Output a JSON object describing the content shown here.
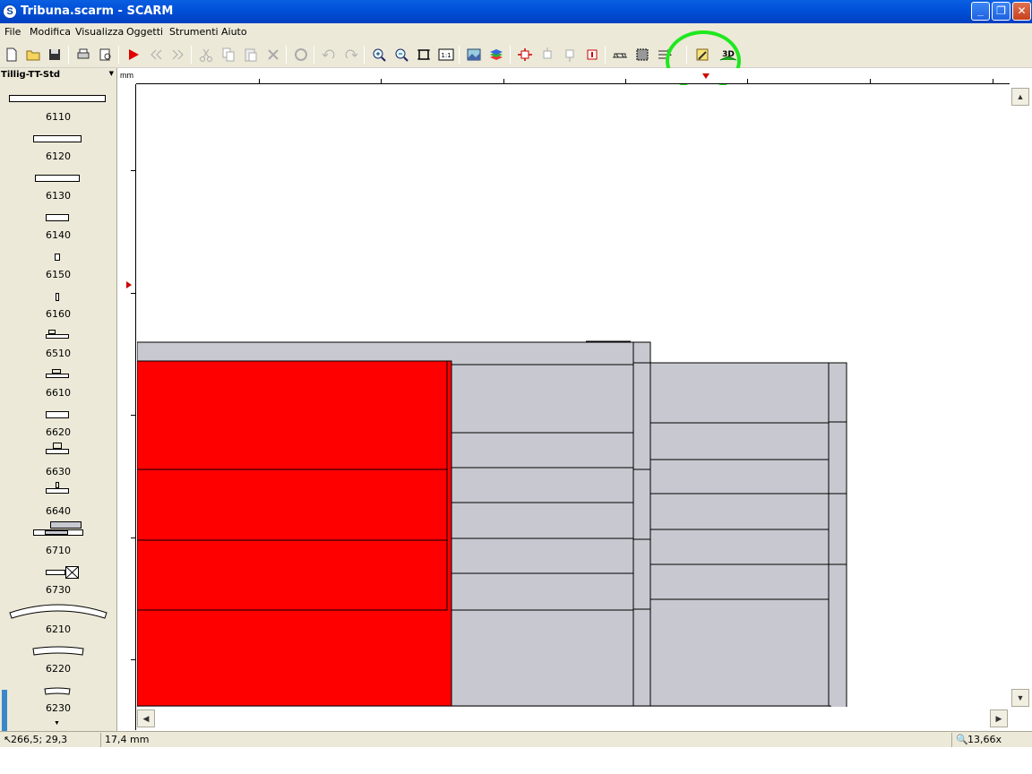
{
  "window": {
    "title": "Tribuna.scarm - SCARM",
    "app_icon": "S",
    "minimize_glyph": "_",
    "restore_glyph": "❐",
    "close_glyph": "✕"
  },
  "menu": {
    "items": [
      "File",
      "Modifica",
      "Visualizza",
      "Oggetti",
      "Strumenti",
      "Aiuto"
    ]
  },
  "toolbar": {
    "tools": [
      "new-icon",
      "open-icon",
      "save-icon",
      "print-icon",
      "print-preview-icon",
      "select-arrow-icon",
      "prev-icon",
      "next-icon",
      "cut-icon",
      "copy-icon",
      "paste-icon",
      "delete-icon",
      "rotate-icon",
      "undo-icon",
      "redo-icon",
      "zoom-in-icon",
      "zoom-out-icon",
      "fit-icon",
      "zoom-1to1-icon",
      "background-image-icon",
      "layers-icon",
      "track-tool-1-icon",
      "track-tool-2-icon",
      "track-tool-3-icon",
      "track-tool-4-icon",
      "bridge-icon",
      "selection-box-icon",
      "flex-track-icon",
      "measure-icon",
      "view-3d-icon"
    ],
    "zoom_1to1_label": "1:1",
    "view_3d_label": "3D",
    "highlight_color": "#1ee81e"
  },
  "library": {
    "selected": "Tillig-TT-Std",
    "pieces": [
      "6110",
      "6120",
      "6130",
      "6140",
      "6150",
      "6160",
      "6510",
      "6610",
      "6620",
      "6630",
      "6640",
      "6710",
      "6730",
      "6210",
      "6220",
      "6230"
    ]
  },
  "canvas": {
    "ruler_unit": "mm",
    "colors": {
      "red_block": "#ff0000",
      "grey_block": "#c8c8d0",
      "outline": "#000000"
    }
  },
  "status": {
    "coordinates": "266,5; 29,3",
    "measure": "17,4 mm",
    "zoom": "13,66x"
  }
}
